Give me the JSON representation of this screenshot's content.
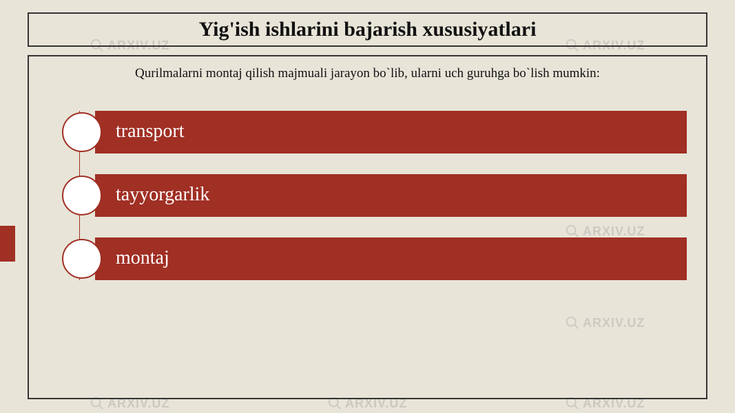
{
  "watermark_text": "ARXIV.UZ",
  "title": "Yig'ish ishlarini bajarish xususiyatlari",
  "subtitle": "Qurilmalarni montaj qilish majmuali jarayon bo`lib, ularni uch guruhga bo`lish mumkin:",
  "items": [
    {
      "label": "transport"
    },
    {
      "label": "tayyorgarlik"
    },
    {
      "label": "montaj"
    }
  ]
}
